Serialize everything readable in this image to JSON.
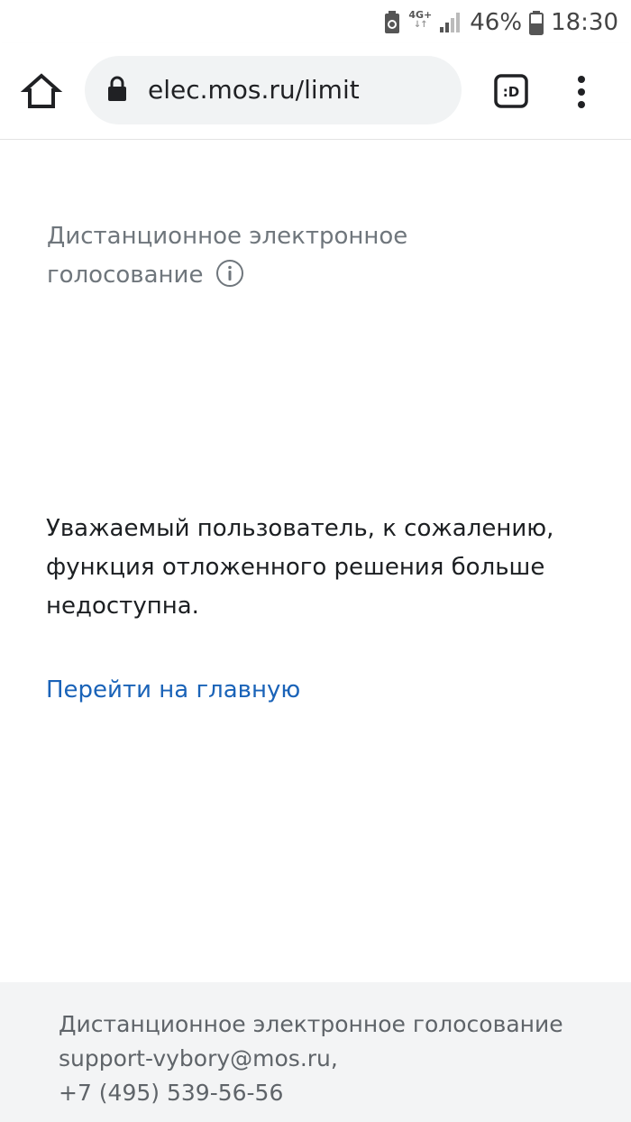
{
  "status_bar": {
    "network_type": "4G+",
    "network_arrows": "↓↑",
    "battery_percent": "46%",
    "time": "18:30",
    "icons": [
      "battery-saver-icon",
      "signal-icon",
      "battery-icon"
    ]
  },
  "browser": {
    "url": "elec.mos.ru/limit",
    "icons": [
      "home-icon",
      "lock-icon",
      "extension-icon",
      "overflow-menu-icon"
    ],
    "extension_label": ":D"
  },
  "page": {
    "service_title": "Дистанционное электронное голосование",
    "message": "Уважаемый пользователь, к сожалению, функция отложенного решения больше недоступна.",
    "home_link": "Перейти на главную",
    "colors": {
      "title_text": "#6f767c",
      "body_text": "#1c1f22",
      "link": "#1a63b8"
    }
  },
  "footer": {
    "title": "Дистанционное электронное голосование",
    "email": "support-vybory@mos.ru,",
    "phone": "+7 (495) 539-56-56",
    "background": "#f3f4f5"
  }
}
